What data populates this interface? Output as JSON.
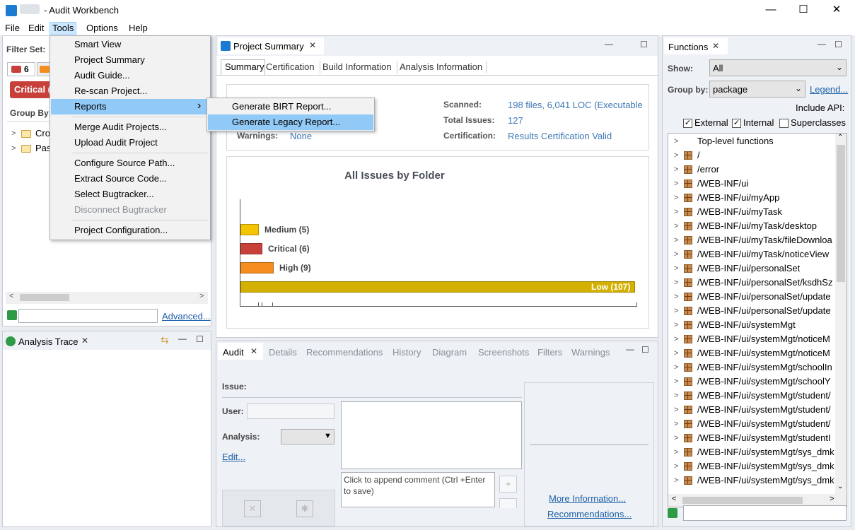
{
  "window": {
    "title": "- Audit Workbench",
    "minimize": "—",
    "maximize": "☐",
    "close": "✕"
  },
  "menubar": [
    "File",
    "Edit",
    "Tools",
    "Options",
    "Help"
  ],
  "tools_menu": {
    "items": [
      "Smart View",
      "Project Summary",
      "Audit Guide...",
      "Re-scan Project...",
      "Reports",
      "Merge Audit Projects...",
      "Upload Audit Project",
      "Configure Source Path...",
      "Extract Source Code...",
      "Select Bugtracker...",
      "Disconnect Bugtracker",
      "Project Configuration..."
    ],
    "submenu_arrow": "›"
  },
  "reports_submenu": {
    "items": [
      "Generate BIRT Report...",
      "Generate Legacy Report..."
    ]
  },
  "left_panel": {
    "filter_set_label": "Filter Set:",
    "tab_count": "6",
    "critical_badge": "Critical (",
    "group_by_label": "Group By:",
    "tree": [
      "Cro",
      "Pas"
    ],
    "advanced_link": "Advanced..."
  },
  "analysis_trace": {
    "title": "Analysis Trace"
  },
  "project_summary": {
    "title": "Project Summary",
    "tabs": [
      "Summary",
      "Certification",
      "Build Information",
      "Analysis Information"
    ],
    "warnings_label": "Warnings:",
    "warnings_value": "None",
    "scanned_label": "Scanned:",
    "scanned_value": "198 files, 6,041 LOC (Executable",
    "total_issues_label": "Total Issues:",
    "total_issues_value": "127",
    "certification_label": "Certification:",
    "certification_value": "Results Certification Valid"
  },
  "chart_data": {
    "type": "bar",
    "title": "All Issues by Folder",
    "orientation": "horizontal",
    "categories": [
      "Medium",
      "Critical",
      "High",
      "Low"
    ],
    "values": [
      5,
      6,
      9,
      107
    ],
    "labels": [
      "Medium (5)",
      "Critical (6)",
      "High (9)",
      "Low (107)"
    ],
    "colors": [
      "#f5c400",
      "#c8403a",
      "#f58c1e",
      "#d4b000"
    ],
    "xlim": [
      0,
      107
    ]
  },
  "audit_panel": {
    "tabs": [
      "Audit",
      "Details",
      "Recommendations",
      "History",
      "Diagram",
      "Screenshots",
      "Filters",
      "Warnings"
    ],
    "issue_label": "Issue:",
    "user_label": "User:",
    "analysis_label": "Analysis:",
    "edit_link": "Edit...",
    "comment_placeholder": "Click to append comment (Ctrl +Enter to save)",
    "more_info_link": "More Information...",
    "recommendations_link": "Recommendations..."
  },
  "functions_panel": {
    "title": "Functions",
    "show_label": "Show:",
    "show_value": "All",
    "group_by_label": "Group by:",
    "group_by_value": "package",
    "legend_link": "Legend...",
    "include_api_label": "Include API:",
    "external_label": "External",
    "internal_label": "Internal",
    "superclasses_label": "Superclasses",
    "external_checked": true,
    "internal_checked": true,
    "superclasses_checked": false,
    "items": [
      "Top-level functions",
      "/",
      "/error",
      "/WEB-INF/ui",
      "/WEB-INF/ui/myApp",
      "/WEB-INF/ui/myTask",
      "/WEB-INF/ui/myTask/desktop",
      "/WEB-INF/ui/myTask/fileDownloa",
      "/WEB-INF/ui/myTask/noticeView",
      "/WEB-INF/ui/personalSet",
      "/WEB-INF/ui/personalSet/ksdhSz",
      "/WEB-INF/ui/personalSet/update",
      "/WEB-INF/ui/personalSet/update",
      "/WEB-INF/ui/systemMgt",
      "/WEB-INF/ui/systemMgt/noticeM",
      "/WEB-INF/ui/systemMgt/noticeM",
      "/WEB-INF/ui/systemMgt/schoolIn",
      "/WEB-INF/ui/systemMgt/schoolY",
      "/WEB-INF/ui/systemMgt/student/",
      "/WEB-INF/ui/systemMgt/student/",
      "/WEB-INF/ui/systemMgt/student/",
      "/WEB-INF/ui/systemMgt/studentI",
      "/WEB-INF/ui/systemMgt/sys_dmk",
      "/WEB-INF/ui/systemMgt/sys_dmk",
      "/WEB-INF/ui/systemMgt/sys_dmk"
    ]
  }
}
